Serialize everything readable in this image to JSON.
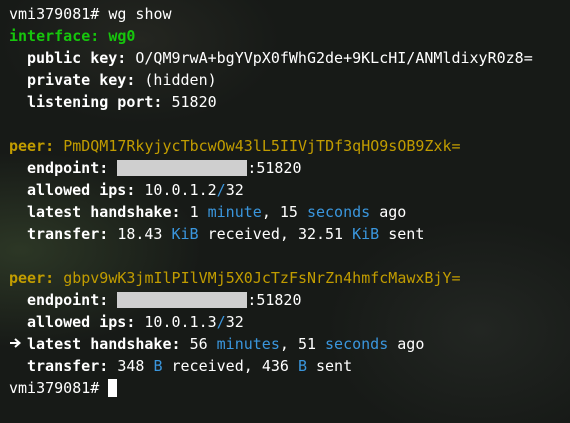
{
  "prompt1": "vmi379081# ",
  "cmd": "wg show",
  "interface": {
    "label": "interface:",
    "name": "wg0",
    "public_key_label": "public key:",
    "public_key": "O/QM9rwA+bgYVpX0fWhG2de+9KLcHI/ANMldixyR0z8=",
    "private_key_label": "private key:",
    "private_key": "(hidden)",
    "port_label": "listening port:",
    "port": "51820"
  },
  "peers": [
    {
      "label": "peer:",
      "key": "PmDQM17RkyjycTbcwOw43lL5IIVjTDf3qHO9sOB9Zxk=",
      "endpoint_label": "endpoint:",
      "endpoint_port": ":51820",
      "allowed_label": "allowed ips:",
      "allowed_ip": "10.0.1.2",
      "allowed_slash": "/",
      "allowed_mask": "32",
      "hs_label": "latest handshake:",
      "hs_n1": "1",
      "hs_u1": "minute",
      "hs_sep": ",",
      "hs_n2": "15",
      "hs_u2": "seconds",
      "hs_ago": "ago",
      "tr_label": "transfer:",
      "rx": "18.43",
      "rx_unit": "KiB",
      "rx_word": "received,",
      "tx": "32.51",
      "tx_unit": "KiB",
      "tx_word": "sent"
    },
    {
      "label": "peer:",
      "key": "gbpv9wK3jmIlPIlVMj5X0JcTzFsNrZn4hmfcMawxBjY=",
      "endpoint_label": "endpoint:",
      "endpoint_port": ":51820",
      "allowed_label": "allowed ips:",
      "allowed_ip": "10.0.1.3",
      "allowed_slash": "/",
      "allowed_mask": "32",
      "hs_label": "latest handshake:",
      "hs_n1": "56",
      "hs_u1": "minutes",
      "hs_sep": ",",
      "hs_n2": "51",
      "hs_u2": "seconds",
      "hs_ago": "ago",
      "tr_label": "transfer:",
      "rx": "348",
      "rx_unit": "B",
      "rx_word": "received,",
      "tx": "436",
      "tx_unit": "B",
      "tx_word": "sent"
    }
  ],
  "prompt2": "vmi379081# ",
  "icons": {
    "pointer": "arrow-pointer-icon",
    "cursor": "block-cursor"
  },
  "colors": {
    "green": "#16c60c",
    "yellow": "#c19c00",
    "cyan": "#3a96dd"
  }
}
